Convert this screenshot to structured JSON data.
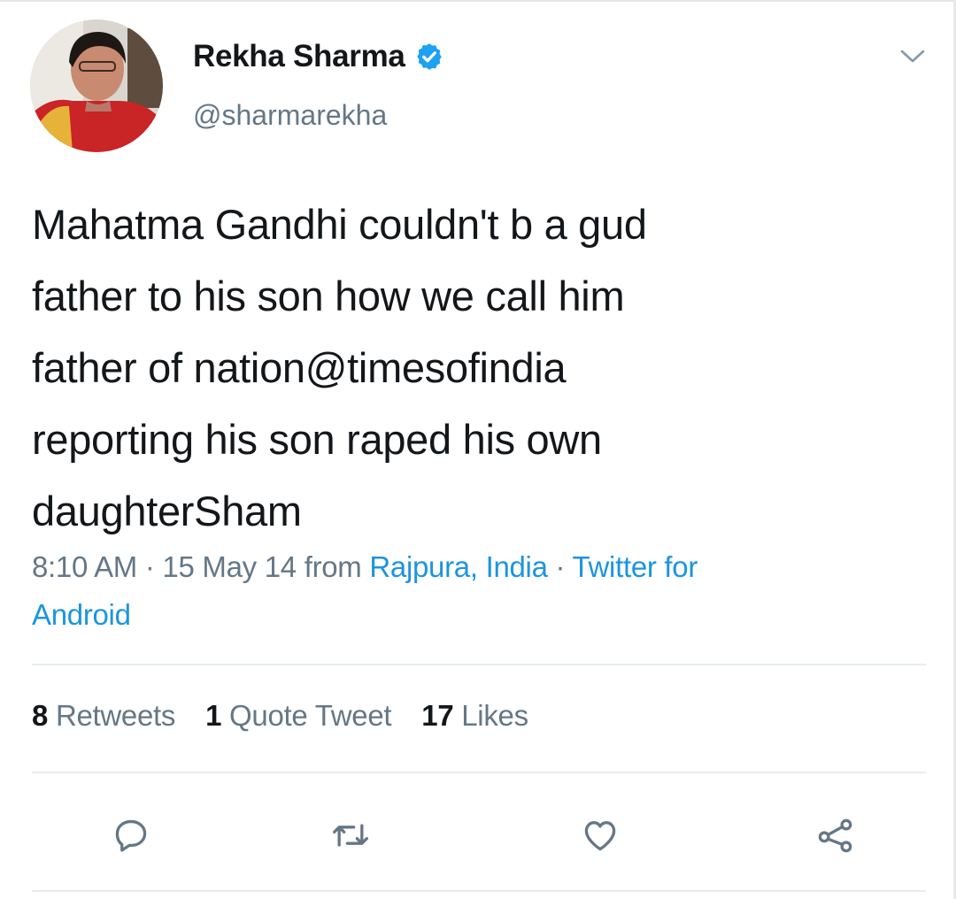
{
  "author": {
    "name": "Rekha Sharma",
    "handle": "@sharmarekha",
    "verified": true,
    "verified_icon": "verified-badge-icon"
  },
  "tweet": {
    "text": "Mahatma Gandhi couldn't b a gud\nfather to his son how we call him\nfather of nation@timesofindia\nreporting his son raped his own\ndaughterSham"
  },
  "meta": {
    "time": "8:10 AM",
    "separator1": " · ",
    "date": "15 May 14",
    "from_label": " from ",
    "location": "Rajpura, India",
    "separator2": " · ",
    "source_line1": "Twitter for",
    "source_line2": "Android"
  },
  "stats": {
    "retweets_count": "8",
    "retweets_label": "Retweets",
    "quotes_count": "1",
    "quotes_label": "Quote Tweet",
    "likes_count": "17",
    "likes_label": "Likes"
  },
  "actions": {
    "reply_icon": "reply-icon",
    "retweet_icon": "retweet-icon",
    "like_icon": "heart-icon",
    "share_icon": "share-icon",
    "menu_icon": "chevron-down-icon"
  },
  "colors": {
    "link": "#1b95e0",
    "secondary_text": "#657786",
    "primary_text": "#14171a",
    "verified": "#1da1f2"
  }
}
